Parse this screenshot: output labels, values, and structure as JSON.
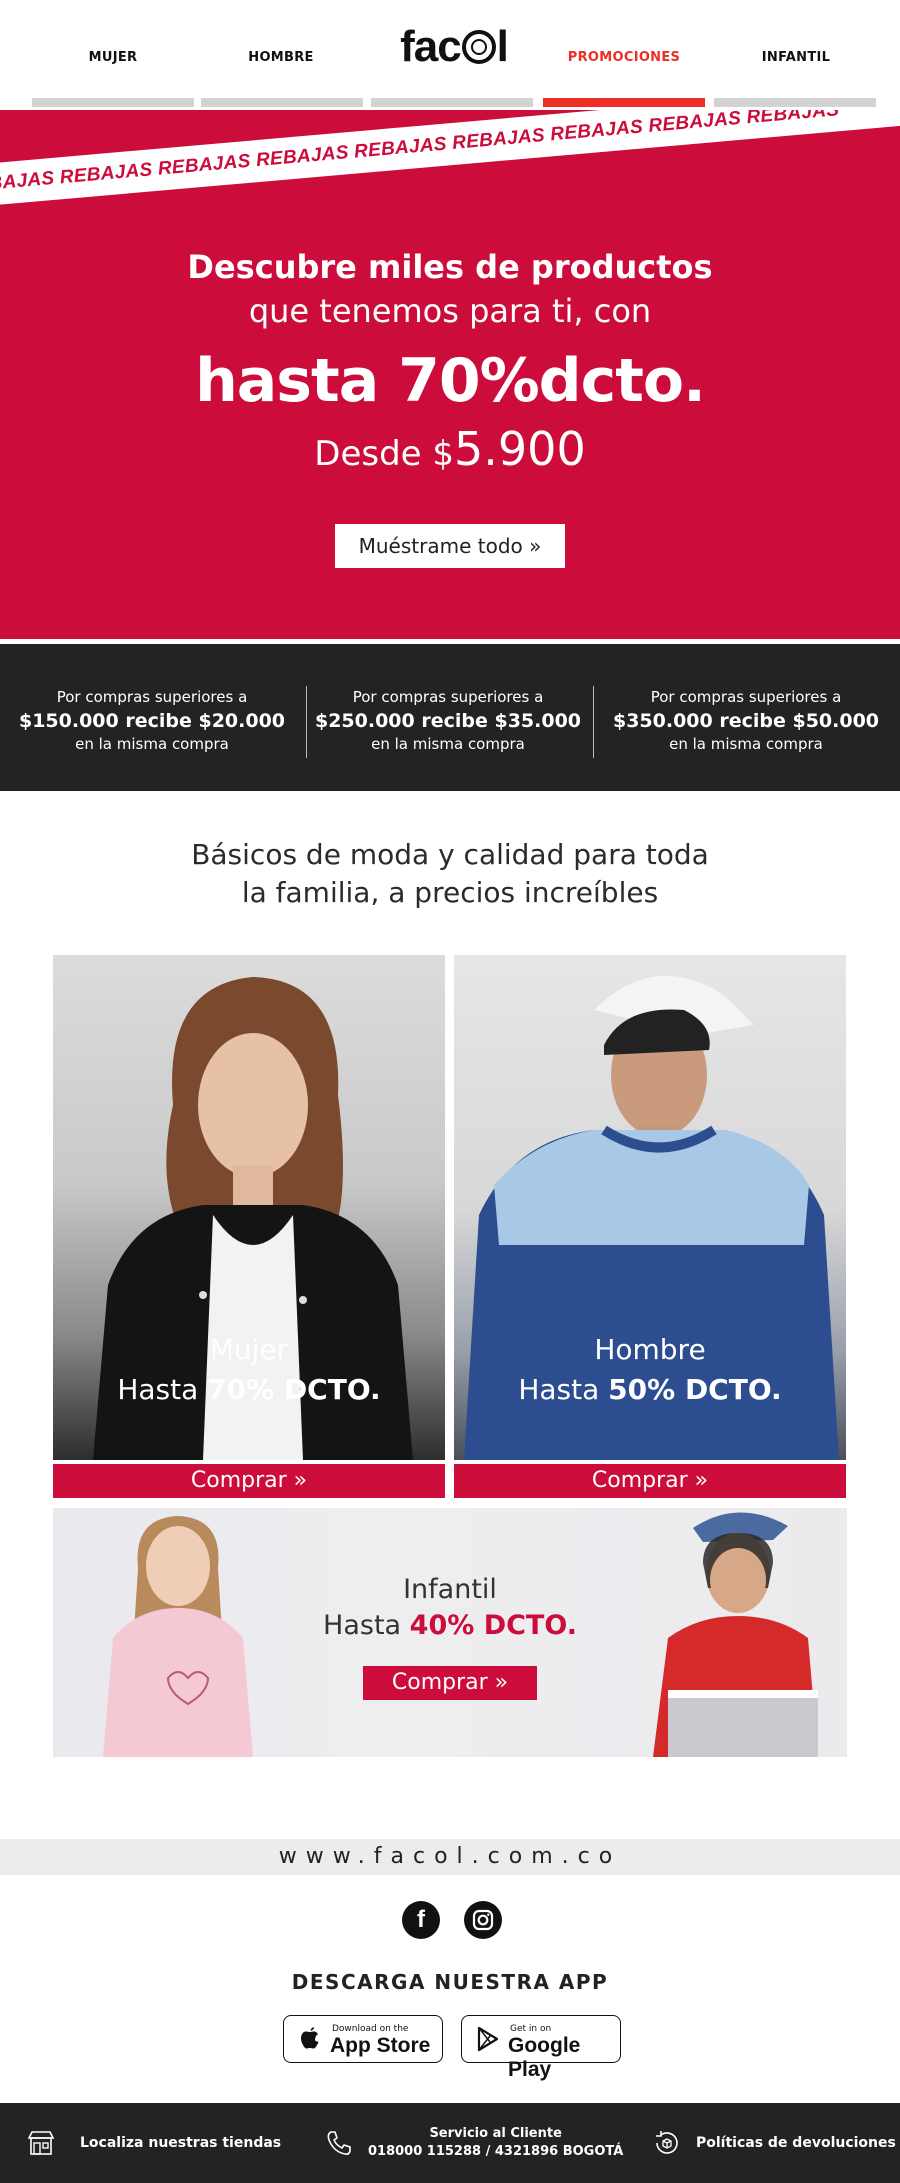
{
  "nav": {
    "items": [
      {
        "label": "MUJER"
      },
      {
        "label": "HOMBRE"
      },
      {
        "label": "PROMOCIONES"
      },
      {
        "label": "INFANTIL"
      }
    ],
    "logo": {
      "pre": "fac",
      "post": "l"
    },
    "active_color": "#ee2e24"
  },
  "hero": {
    "ribbon_text": "REBAJAS REBAJAS REBAJAS REBAJAS REBAJAS REBAJAS REBAJAS REBAJAS REBAJAS",
    "line1": "Descubre miles de productos",
    "line2": "que tenemos para ti, con",
    "line3": "hasta 70%dcto.",
    "line4_prefix": "Desde $",
    "line4_price": "5.900",
    "cta": "Muéstrame todo »",
    "bg_color": "#cc0d3b"
  },
  "promos": [
    {
      "l1": "Por compras superiores a",
      "l2": "$150.000 recibe $20.000",
      "l3": "en la misma compra"
    },
    {
      "l1": "Por compras superiores a",
      "l2": "$250.000 recibe $35.000",
      "l3": "en la misma compra"
    },
    {
      "l1": "Por compras superiores a",
      "l2": "$350.000 recibe $50.000",
      "l3": "en la misma compra"
    }
  ],
  "section": {
    "line1": "Básicos de moda y calidad para toda",
    "line2": "la familia, a precios increíbles"
  },
  "cards": {
    "mujer": {
      "title": "Mujer",
      "prefix": "Hasta ",
      "discount": "70% DCTO.",
      "buy": "Comprar »"
    },
    "hombre": {
      "title": "Hombre",
      "prefix": "Hasta ",
      "discount": "50% DCTO.",
      "buy": "Comprar »"
    },
    "infantil": {
      "title": "Infantil",
      "prefix": "Hasta ",
      "discount": "40% DCTO.",
      "buy": "Comprar »"
    }
  },
  "footer": {
    "url": "www.facol.com.co",
    "social": [
      {
        "icon": "facebook-icon",
        "glyph": "f"
      },
      {
        "icon": "instagram-icon"
      }
    ],
    "app_title": "DESCARGA NUESTRA APP",
    "app_store": {
      "small": "Download on the",
      "big": "App Store"
    },
    "google_play": {
      "small": "Get in on",
      "big": "Google Play"
    },
    "stores_label": "Localiza nuestras tiendas",
    "service_title": "Servicio al Cliente",
    "service_phone": "018000 115288 / 4321896 BOGOTÁ",
    "returns": "Políticas de devoluciones"
  }
}
